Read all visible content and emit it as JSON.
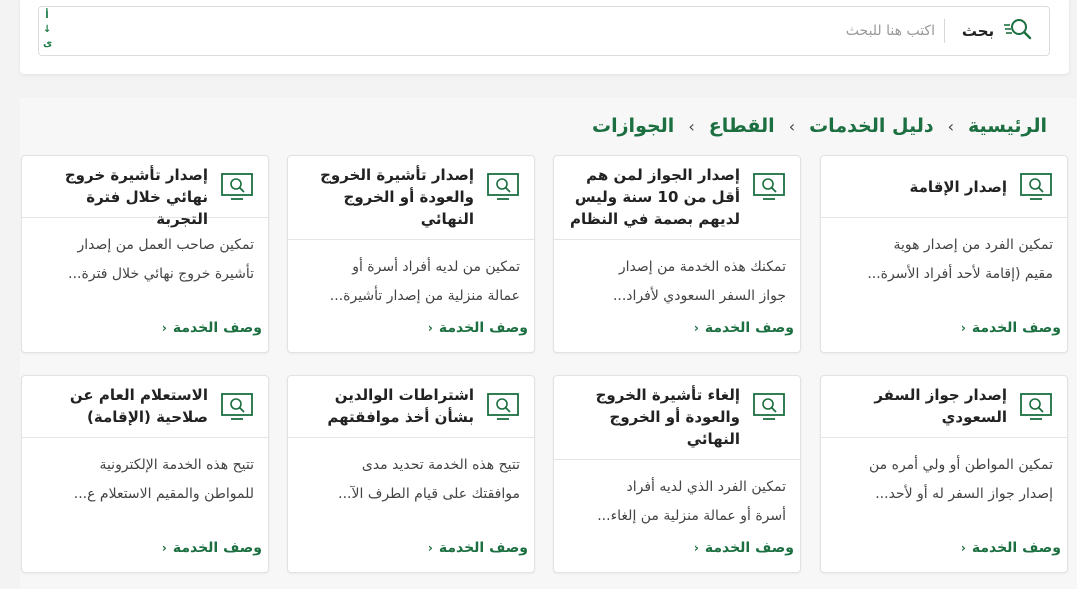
{
  "search": {
    "button_label": "بحث",
    "placeholder": "اكتب هنا للبحث",
    "value": "",
    "keyboard_glyphs": [
      "أ",
      "↓",
      "ى"
    ]
  },
  "breadcrumb": {
    "items": [
      "الرئيسية",
      "دليل الخدمات",
      "القطاع",
      "الجوازات"
    ],
    "separator": "‹"
  },
  "link_label": "وصف الخدمة",
  "link_arrow": "‹",
  "accent": "#1b6f40",
  "cards": [
    {
      "title": "إصدار الإقامة",
      "desc_line1": "تمكين الفرد من إصدار هوية",
      "desc_line2": "مقيم (إقامة لأحد أفراد الأسرة..."
    },
    {
      "title": "إصدار الجواز لمن هم أقل من 10 سنة وليس لديهم بصمة في النظام",
      "desc_line1": "تمكنك هذه الخدمة من إصدار",
      "desc_line2": "جواز السفر السعودي لأفراد..."
    },
    {
      "title": "إصدار تأشيرة الخروج والعودة أو الخروج النهائي",
      "desc_line1": "تمكين من لديه أفراد أسرة أو",
      "desc_line2": "عمالة منزلية من إصدار تأشيرة..."
    },
    {
      "title": "إصدار تأشيرة خروج نهائي خلال فترة التجربة",
      "desc_line1": "تمكين صاحب العمل من إصدار",
      "desc_line2": "تأشيرة خروج نهائي خلال فترة..."
    },
    {
      "title": "إصدار جواز السفر السعودي",
      "desc_line1": "تمكين المواطن أو ولي أمره من",
      "desc_line2": "إصدار جواز السفر له أو لأحد..."
    },
    {
      "title": "إلغاء تأشيرة الخروج والعودة أو الخروج النهائي",
      "desc_line1": "تمكين الفرد الذي لديه أفراد",
      "desc_line2": "أسرة أو عمالة منزلية من إلغاء..."
    },
    {
      "title": "اشتراطات الوالدين بشأن أخذ موافقتهم",
      "desc_line1": "تتيح هذه الخدمة تحديد مدى",
      "desc_line2": "موافقتك على قيام الطرف الآ..."
    },
    {
      "title": "الاستعلام العام عن صلاحية (الإقامة)",
      "desc_line1": "تتيح هذه الخدمة الإلكترونية",
      "desc_line2": "للمواطن والمقيم الاستعلام ع..."
    }
  ]
}
